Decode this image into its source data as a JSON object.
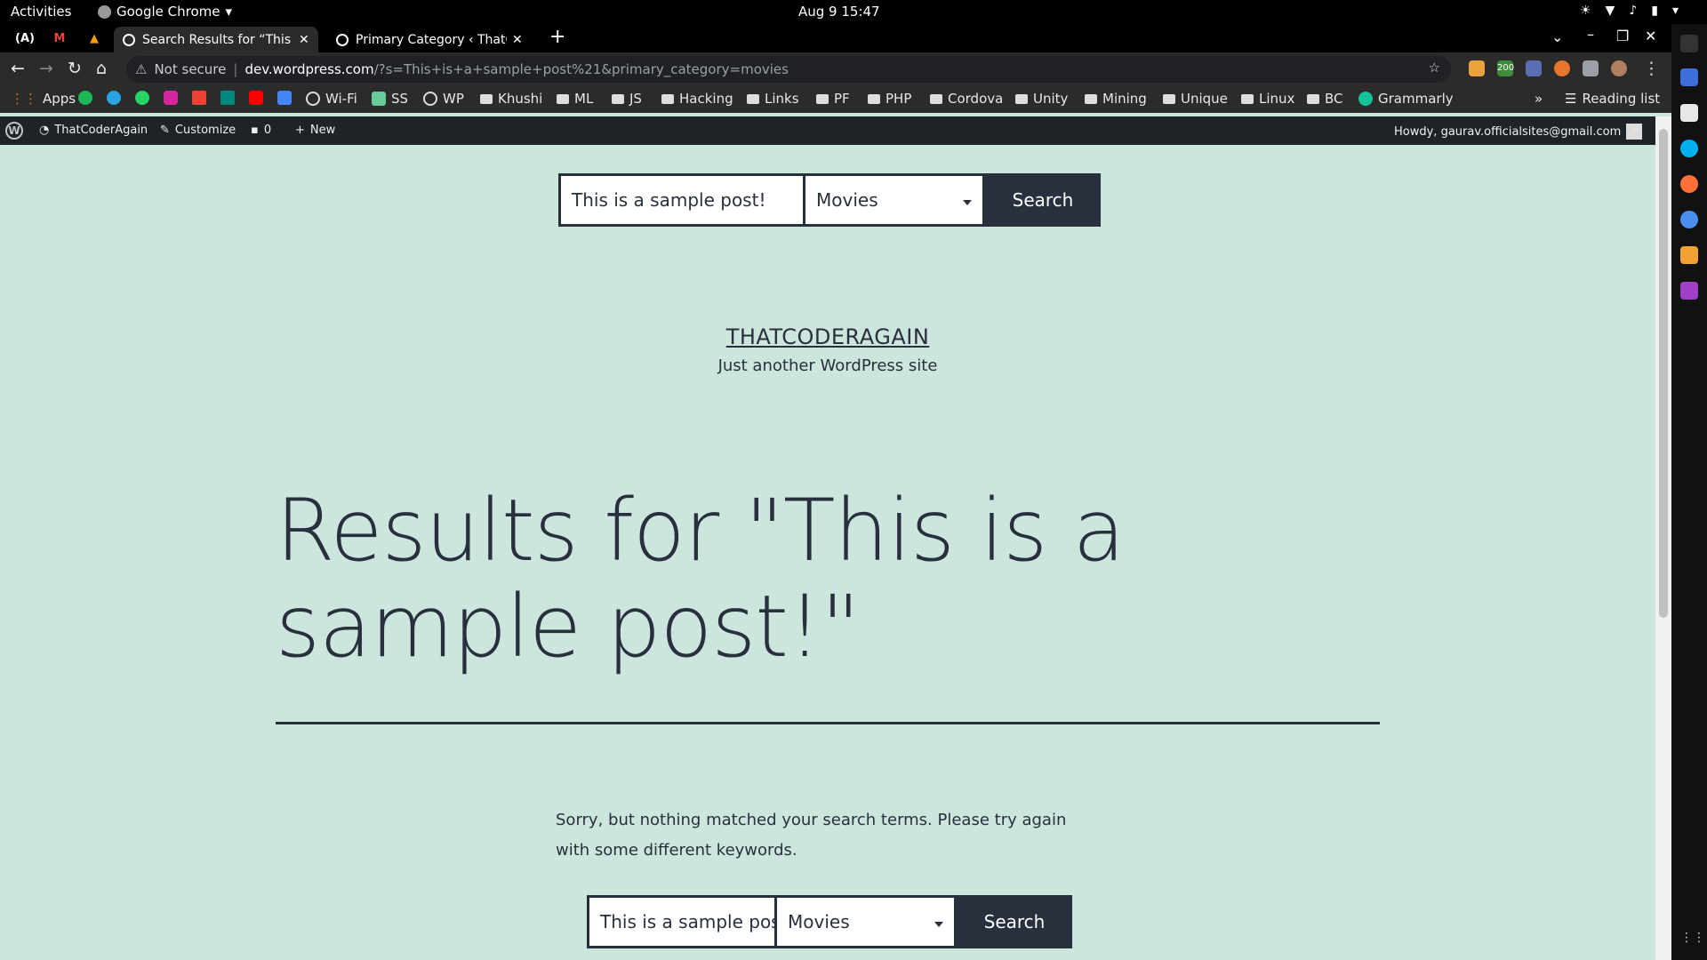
{
  "system": {
    "activities": "Activities",
    "app_name": "Google Chrome",
    "clock": "Aug 9  15:47"
  },
  "browser": {
    "tabs": [
      {
        "title": "Search Results for “This is",
        "active": true
      },
      {
        "title": "Primary Category ‹ ThatCo",
        "active": false
      }
    ],
    "security_label": "Not secure",
    "url_host": "dev.wordpress.com",
    "url_path": "/?s=This+is+a+sample+post%21&primary_category=movies",
    "extension_badge": "200",
    "bookmarks": [
      {
        "label": "Apps",
        "kind": "apps"
      },
      {
        "label": "Wi-Fi",
        "kind": "site"
      },
      {
        "label": "SS",
        "kind": "site"
      },
      {
        "label": "WP",
        "kind": "site"
      },
      {
        "label": "Khushi",
        "kind": "folder"
      },
      {
        "label": "ML",
        "kind": "folder"
      },
      {
        "label": "JS",
        "kind": "folder"
      },
      {
        "label": "Hacking",
        "kind": "folder"
      },
      {
        "label": "Links",
        "kind": "folder"
      },
      {
        "label": "PF",
        "kind": "folder"
      },
      {
        "label": "PHP",
        "kind": "folder"
      },
      {
        "label": "Cordova",
        "kind": "folder"
      },
      {
        "label": "Unity",
        "kind": "folder"
      },
      {
        "label": "Mining",
        "kind": "folder"
      },
      {
        "label": "Unique",
        "kind": "folder"
      },
      {
        "label": "Linux",
        "kind": "folder"
      },
      {
        "label": "BC",
        "kind": "folder"
      },
      {
        "label": "Grammarly",
        "kind": "site"
      }
    ],
    "overflow": "»",
    "reading_list": "Reading list"
  },
  "admin_bar": {
    "site_name": "ThatCoderAgain",
    "customize": "Customize",
    "comments_count": "0",
    "new_label": "New",
    "howdy": "Howdy, gaurav.officialsites@gmail.com"
  },
  "page": {
    "top_search": {
      "query": "This is a sample post!",
      "category": "Movies",
      "button": "Search"
    },
    "site_title": "THATCODERAGAIN",
    "site_description": "Just another WordPress site",
    "results_heading": "Results for \"This is a sample post!\"",
    "no_results_text": "Sorry, but nothing matched your search terms. Please try again with some different keywords.",
    "bottom_search": {
      "query": "This is a sample post!",
      "category": "Movies",
      "button": "Search"
    }
  },
  "colors": {
    "page_background": "#cce5dd",
    "text": "#28303d",
    "admin_bar": "#1d2327",
    "browser_chrome": "#2b2b2b"
  }
}
